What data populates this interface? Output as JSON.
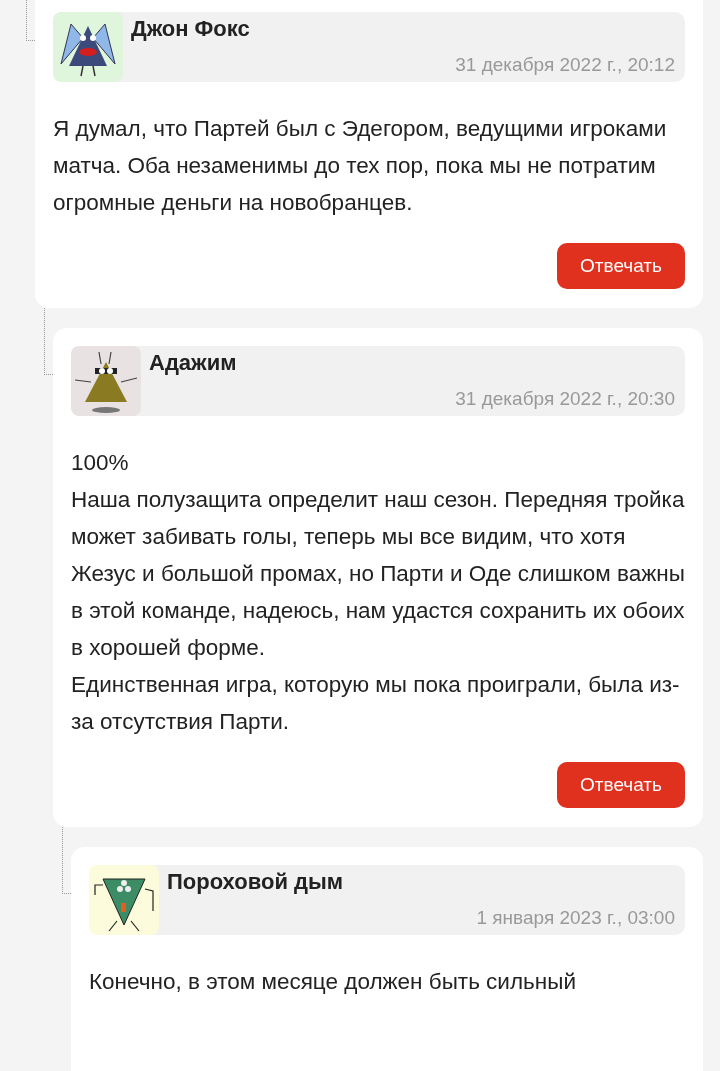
{
  "comments": [
    {
      "author": "Джон Фокс",
      "date": "31 декабря 2022 г., 20:12",
      "paragraphs": [
        "Я думал, что Партей был с Эдегором, ведущими игроками матча. Оба незаменимы до тех пор, пока мы не потратим огромные деньги на новобранцев."
      ],
      "reply_button": "Отвечать",
      "children": [
        {
          "author": "Адажим",
          "date": "31 декабря 2022 г., 20:30",
          "paragraphs": [
            "100%",
            "Наша полузащита определит наш сезон. Передняя тройка может забивать голы, теперь мы все видим, что хотя Жезус и большой промах, но Парти и Оде слишком важны в этой команде, надеюсь, нам удастся сохранить их обоих в хорошей форме.",
            "Единственная игра, которую мы пока проиграли, была из-за отсутствия Парти."
          ],
          "reply_button": "Отвечать",
          "children": [
            {
              "author": "Пороховой дым",
              "date": "1 января 2023 г., 03:00",
              "paragraphs": [
                "Конечно, в этом месяце должен быть сильный"
              ]
            }
          ]
        }
      ]
    }
  ]
}
